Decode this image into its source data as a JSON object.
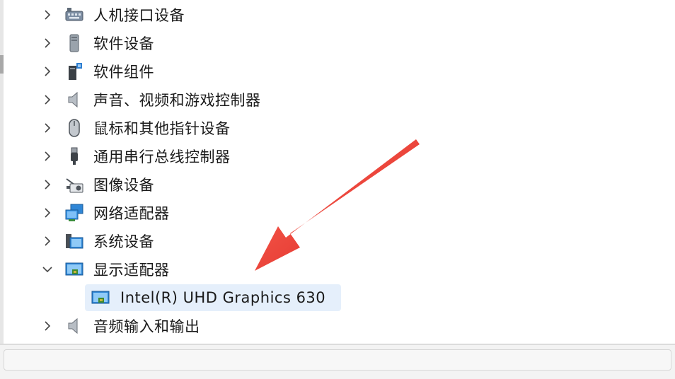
{
  "tree": {
    "items": [
      {
        "label": "人机接口设备",
        "icon": "hid-keyboard-icon",
        "expanded": false
      },
      {
        "label": "软件设备",
        "icon": "software-device-icon",
        "expanded": false
      },
      {
        "label": "软件组件",
        "icon": "software-component-icon",
        "expanded": false
      },
      {
        "label": "声音、视频和游戏控制器",
        "icon": "speaker-icon",
        "expanded": false
      },
      {
        "label": "鼠标和其他指针设备",
        "icon": "mouse-icon",
        "expanded": false
      },
      {
        "label": "通用串行总线控制器",
        "icon": "usb-icon",
        "expanded": false
      },
      {
        "label": "图像设备",
        "icon": "camera-icon",
        "expanded": false
      },
      {
        "label": "网络适配器",
        "icon": "network-adapter-icon",
        "expanded": false
      },
      {
        "label": "系统设备",
        "icon": "system-device-icon",
        "expanded": false
      },
      {
        "label": "显示适配器",
        "icon": "display-adapter-icon",
        "expanded": true,
        "children": [
          {
            "label": "Intel(R) UHD Graphics 630",
            "icon": "display-adapter-icon",
            "selected": true
          }
        ]
      },
      {
        "label": "音频输入和输出",
        "icon": "speaker-icon",
        "expanded": false
      }
    ]
  },
  "colors": {
    "selection": "#e5effb",
    "annotation_arrow": "#e8302c",
    "text": "#1a1a1a"
  }
}
